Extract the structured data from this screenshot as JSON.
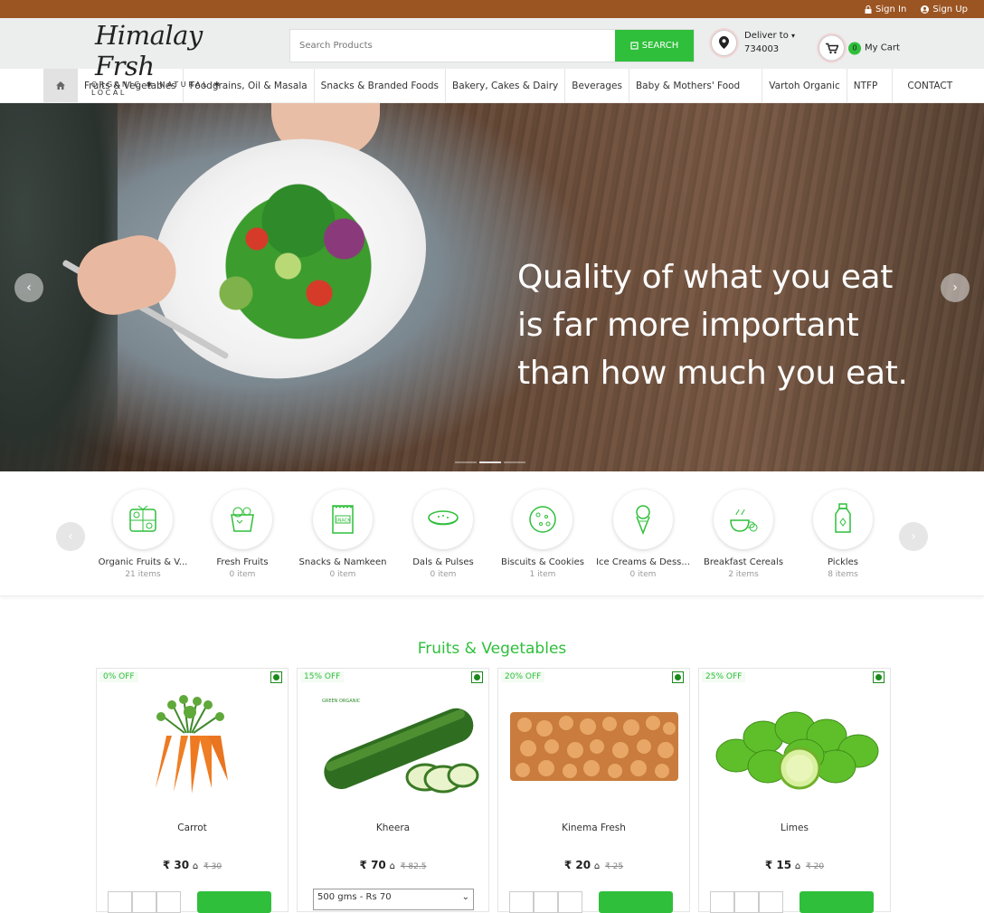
{
  "topbar": {
    "signin": "Sign In",
    "signup": "Sign Up"
  },
  "header": {
    "brand": "Himalay Frsh",
    "tagline": "ORGANIC ✱ NATURAL ✱ LOCAL",
    "search_placeholder": "Search Products",
    "search_button": "SEARCH",
    "deliver_label": "Deliver to",
    "pincode": "734003",
    "cart_count": "0",
    "cart_label": "My Cart"
  },
  "nav": {
    "items": [
      "Fruits & Vegetables",
      "Foodgrains, Oil & Masala",
      "Snacks & Branded Foods",
      "Bakery, Cakes & Dairy",
      "Beverages",
      "Baby & Mothers' Food",
      "Vartoh Organic",
      "NTFP",
      "CONTACT"
    ]
  },
  "hero": {
    "quote_lines": [
      "Quality of what you eat",
      "is far more important",
      "than how much you eat."
    ],
    "prev": "‹",
    "next": "›"
  },
  "categories": [
    {
      "name": "Organic Fruits & V...",
      "count": "21 items",
      "icon": "fruits-basket-icon"
    },
    {
      "name": "Fresh Fruits",
      "count": "0 item",
      "icon": "fruit-bag-icon"
    },
    {
      "name": "Snacks & Namkeen",
      "count": "0 item",
      "icon": "snack-pack-icon"
    },
    {
      "name": "Dals & Pulses",
      "count": "0 item",
      "icon": "pulses-bowl-icon"
    },
    {
      "name": "Biscuits & Cookies",
      "count": "1 item",
      "icon": "cookie-icon"
    },
    {
      "name": "Ice Creams & Dess...",
      "count": "0 item",
      "icon": "ice-cream-icon"
    },
    {
      "name": "Breakfast Cereals",
      "count": "2 items",
      "icon": "cereal-bowl-icon"
    },
    {
      "name": "Pickles",
      "count": "8 items",
      "icon": "pickle-jar-icon"
    }
  ],
  "section": {
    "title": "Fruits & Vegetables"
  },
  "products": [
    {
      "discount": "0% OFF",
      "name": "Carrot",
      "price": "₹ 30",
      "old_price": "₹ 30",
      "image": "carrot-image"
    },
    {
      "discount": "15% OFF",
      "name": "Kheera",
      "price": "₹ 70",
      "old_price": "₹ 82.5",
      "image": "cucumber-image",
      "variant": "500 gms - Rs 70",
      "badge": "GREEN ORGANIC"
    },
    {
      "discount": "20% OFF",
      "name": "Kinema Fresh",
      "price": "₹ 20",
      "old_price": "₹ 25",
      "image": "kinema-image"
    },
    {
      "discount": "25% OFF",
      "name": "Limes",
      "price": "₹ 15",
      "old_price": "₹ 20",
      "image": "limes-image"
    }
  ],
  "colors": {
    "accent": "#2fbf3b",
    "topbar": "#9b5523",
    "header_bg": "#eceeee"
  }
}
